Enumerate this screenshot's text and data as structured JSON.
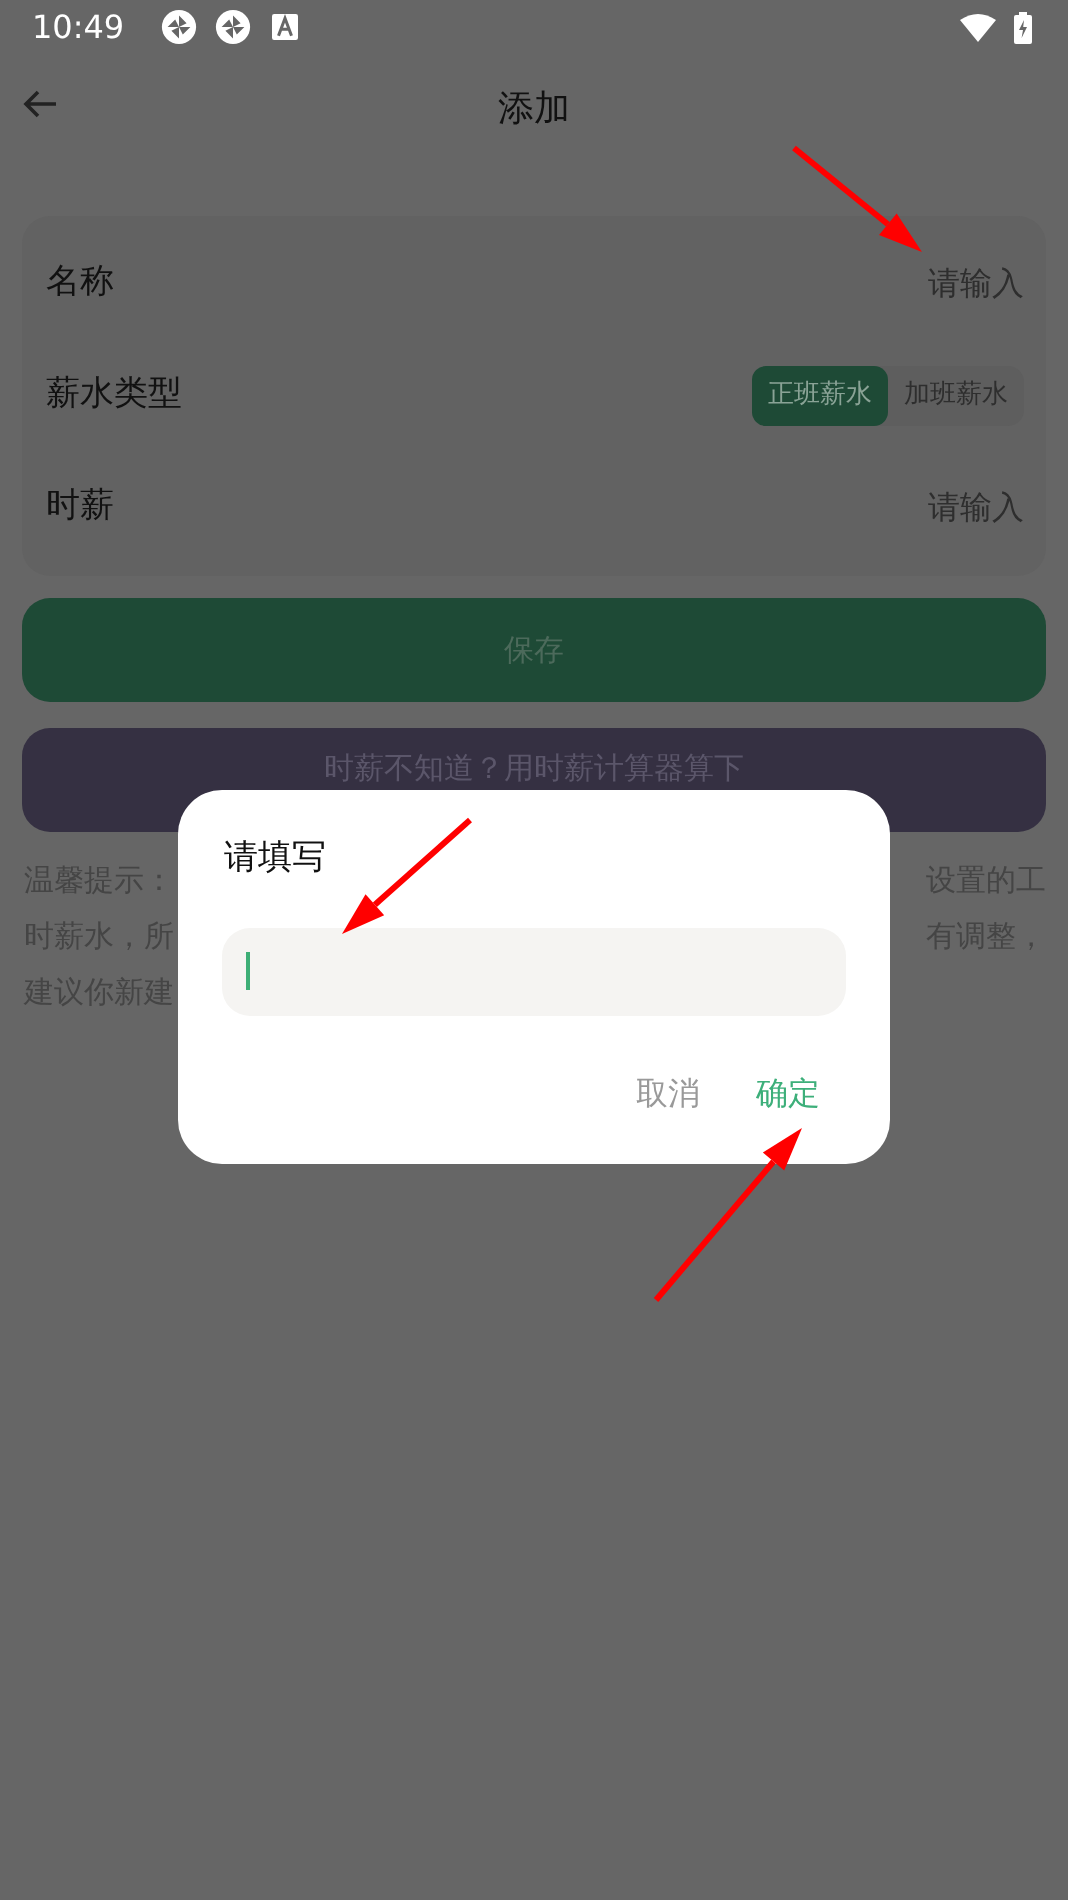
{
  "status_bar": {
    "time": "10:49"
  },
  "header": {
    "title": "添加"
  },
  "form": {
    "rows": [
      {
        "kind": "input",
        "label": "名称",
        "placeholder": "请输入"
      },
      {
        "kind": "segmented",
        "label": "薪水类型",
        "options": [
          {
            "label": "正班薪水",
            "selected": true
          },
          {
            "label": "加班薪水",
            "selected": false
          }
        ]
      },
      {
        "kind": "input",
        "label": "时薪",
        "placeholder": "请输入"
      }
    ]
  },
  "save_button": "保存",
  "calculator_button": "时薪不知道？用时薪计算器算下",
  "tip_lines": [
    {
      "left": "温馨提示：",
      "right": "设置的工"
    },
    {
      "left": "时薪水，所",
      "right": "有调整，"
    },
    {
      "left": "建议你新建"
    }
  ],
  "dialog": {
    "title": "请填写",
    "input": {
      "focused": true
    },
    "buttons": [
      {
        "kind": "cancel",
        "label": "取消"
      },
      {
        "kind": "confirm",
        "label": "确定"
      }
    ]
  }
}
